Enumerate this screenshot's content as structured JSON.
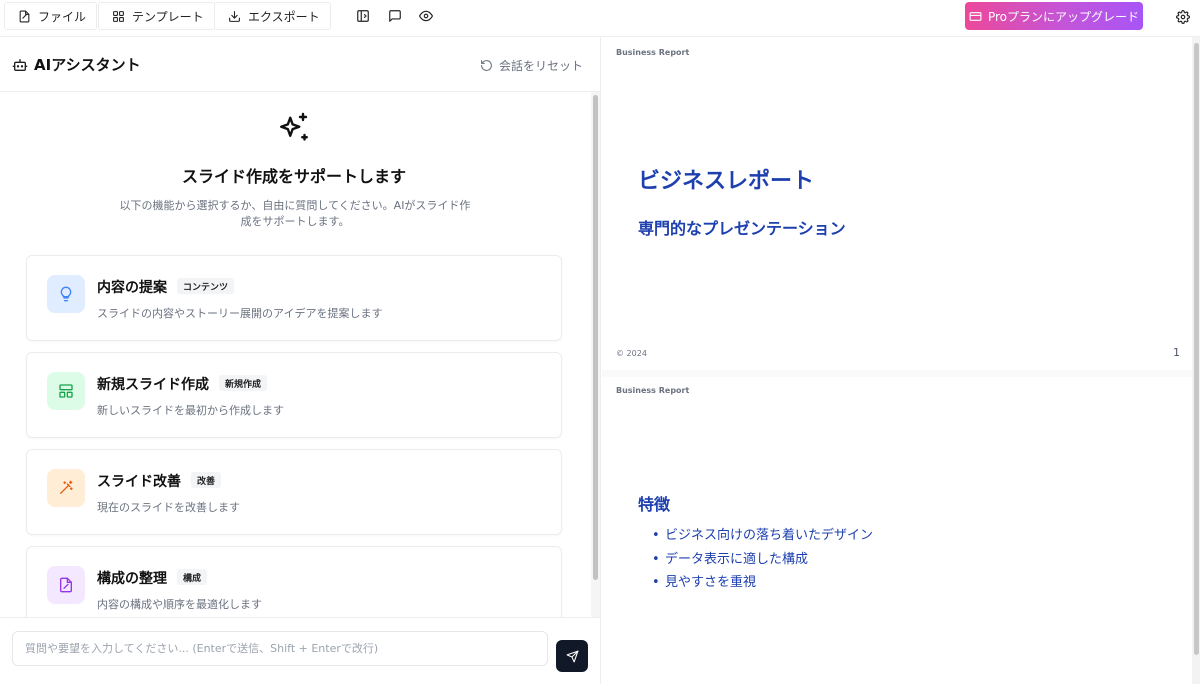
{
  "toolbar": {
    "file_label": "ファイル",
    "template_label": "テンプレート",
    "export_label": "エクスポート",
    "upgrade_label": "Proプランにアップグレード",
    "icons": [
      "file-icon",
      "grid-icon",
      "download-icon",
      "sidebar-icon",
      "comment-icon",
      "eye-icon",
      "credit-card-icon",
      "gear-icon"
    ]
  },
  "assistant": {
    "title": "AIアシスタント",
    "reset_label": "会話をリセット",
    "hero_title": "スライド作成をサポートします",
    "hero_desc": "以下の機能から選択するか、自由に質問してください。AIがスライド作成をサポートします。",
    "cards": [
      {
        "title": "内容の提案",
        "badge": "コンテンツ",
        "desc": "スライドの内容やストーリー展開のアイデアを提案します",
        "icon": "lightbulb-icon",
        "color": "#3b82f6",
        "bg": "#e0ecff"
      },
      {
        "title": "新規スライド作成",
        "badge": "新規作成",
        "desc": "新しいスライドを最初から作成します",
        "icon": "layout-icon",
        "color": "#16a34a",
        "bg": "#dcfce7"
      },
      {
        "title": "スライド改善",
        "badge": "改善",
        "desc": "現在のスライドを改善します",
        "icon": "magic-wand-icon",
        "color": "#ea580c",
        "bg": "#ffedd5"
      },
      {
        "title": "構成の整理",
        "badge": "構成",
        "desc": "内容の構成や順序を最適化します",
        "icon": "file-edit-icon",
        "color": "#9333ea",
        "bg": "#f3e8ff"
      }
    ],
    "input_placeholder": "質問や要望を入力してください... (Enterで送信、Shift + Enterで改行)",
    "input_value": ""
  },
  "slides": [
    {
      "label": "Business Report",
      "title": "ビジネスレポート",
      "subtitle": "専門的なプレゼンテーション",
      "footer": "© 2024",
      "page": "1"
    },
    {
      "label": "Business Report",
      "title": "特徴",
      "bullets": [
        "ビジネス向けの落ち着いたデザイン",
        "データ表示に適した構成",
        "見やすさを重視"
      ]
    }
  ],
  "colors": {
    "accent": "#1e40af",
    "upgrade_gradient": [
      "#ec4899",
      "#a855f7"
    ],
    "send_button": "#111827"
  }
}
